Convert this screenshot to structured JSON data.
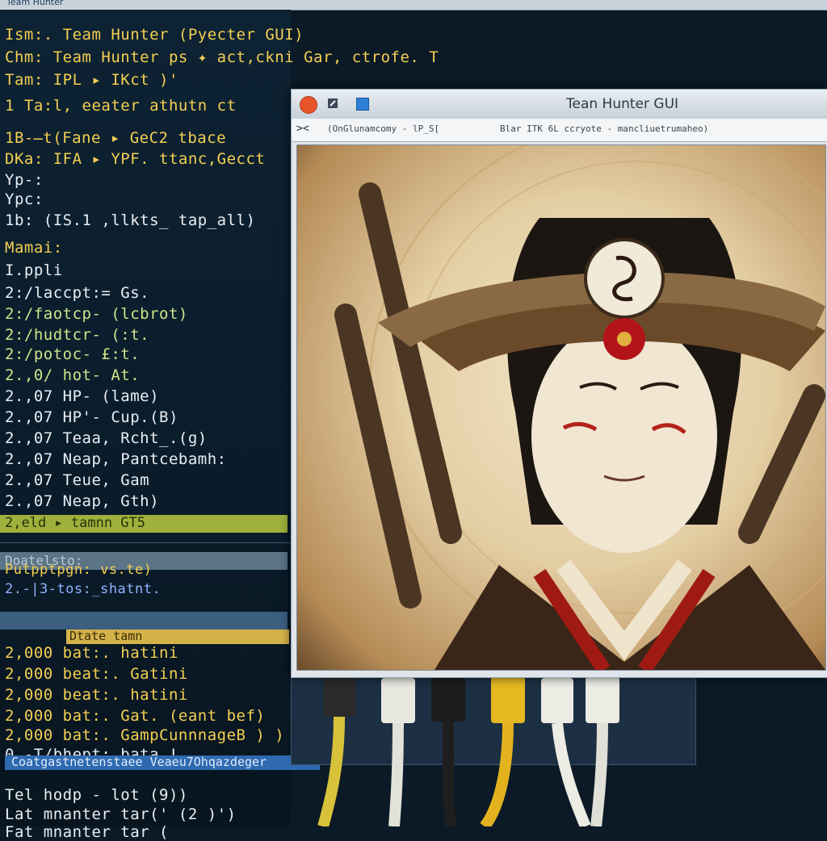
{
  "topbar": {
    "title": "Team Hunter"
  },
  "terminal": {
    "lines": [
      {
        "text": "Ism:.  Team Hunter (Pyecter  GUI)"
      },
      {
        "text": "Chm:   Team Hunter ps ✦ act,ckni Gar, ctrofe.  T"
      },
      {
        "text": "Tam:   IPL  ▸ IKct  )'"
      },
      {
        "text": "1      Ta:l, eeater athutn  ct"
      },
      {
        "text": "1B-̶t(Fane ▸ GeC2 tbace"
      },
      {
        "text": "DKa:   IFA ▸ YPF.  ttanc,Gecct"
      },
      {
        "text": "Yp-:"
      },
      {
        "text": "Ypc:"
      },
      {
        "text": "1b:  (IS.1  ,llkts_  tap_all)"
      },
      {
        "text": "Mamai:"
      },
      {
        "text": "I.ppli"
      },
      {
        "text": "2:/laccpt:= Gs."
      },
      {
        "text": "2:/faotcp- (lcbrot)"
      },
      {
        "text": "2:/hudtcr- (:t."
      },
      {
        "text": "2:/potoc-  £:t."
      },
      {
        "text": "2.,0/ hot-  At."
      },
      {
        "text": "2.,07 HP-  (lame)"
      },
      {
        "text": "2.,07 HP'-  Cup.(B)"
      },
      {
        "text": "2.,07 Teaa, Rcht_.(g)"
      },
      {
        "text": "2.,07 Neap, Pantcebamh:"
      },
      {
        "text": "2.,07 Teue, Gam"
      },
      {
        "text": "2.,07 Neap, Gth)"
      },
      {
        "text": "Putpptpgn:  vs.te)"
      },
      {
        "text": "2.-|3-tos:_shatnt."
      },
      {
        "text": "2,000 bat:.  hatini"
      },
      {
        "text": "2,000 beat:. Gatini"
      },
      {
        "text": "2,000 beat:. hatini"
      },
      {
        "text": "2,000 bat:.  Gat.  (eant  bef)"
      },
      {
        "text": "2,000 bat:.  GampCunnnageB ) )"
      },
      {
        "text": "0.-T/bhept:  bata  !"
      },
      {
        "text": "Tel hodp  - lot  (9))"
      },
      {
        "text": "Lat mnanter  tar(' (2 )')"
      },
      {
        "text": "Fat mnanter  tar  ("
      }
    ],
    "highlight_green": "2,eld ▸ tamnn   GT5",
    "highlight_grey": "Doatelsto:",
    "highlight_yellow": "Dtate tamn",
    "highlight_blue": "Coatgastnetenstaee Veaeu7Ohqazdeger"
  },
  "window": {
    "title": "Tean Hunter GUI",
    "path_left": "(OnGlunamcomy - lP_S[",
    "path_right": "Blar ITK 6L ccryote - mancliuetrumaheo)",
    "image_description_icon": "samurai-portrait-image"
  },
  "colors": {
    "accent_close": "#e8552b",
    "accent_save": "#2e7fd6",
    "terminal_yellow": "#f4cf52",
    "terminal_green": "#cfe38a"
  }
}
